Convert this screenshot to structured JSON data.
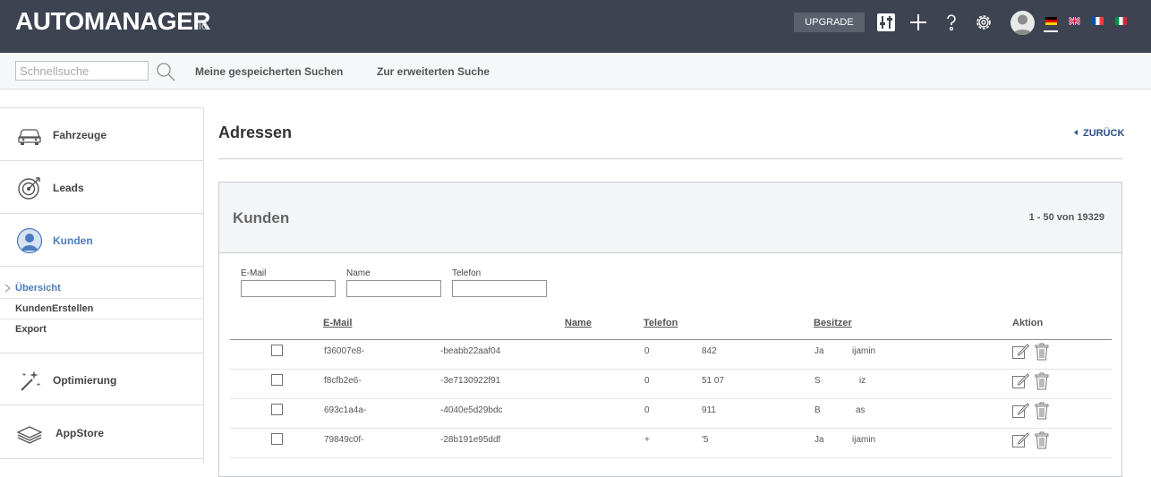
{
  "header": {
    "logo": "AUTOMANAGER",
    "logo_suffix": "io",
    "upgrade_label": "UPGRADE",
    "icons": [
      "sliders-icon",
      "plus-icon",
      "help-icon",
      "gear-icon",
      "avatar",
      "flag-de-icon",
      "flag-gb-icon",
      "flag-fr-icon",
      "flag-it-icon"
    ]
  },
  "searchbar": {
    "placeholder": "Schnellsuche",
    "saved_searches": "Meine gespeicherten Suchen",
    "advanced_search": "Zur erweiterten Suche"
  },
  "sidebar": {
    "items": [
      {
        "label": "Fahrzeuge",
        "icon": "car-icon"
      },
      {
        "label": "Leads",
        "icon": "target-icon"
      },
      {
        "label": "Kunden",
        "icon": "person-icon"
      },
      {
        "label": "Optimierung",
        "icon": "magic-wand-icon"
      },
      {
        "label": "AppStore",
        "icon": "layers-icon"
      }
    ],
    "sub_items": [
      {
        "label": "Übersicht"
      },
      {
        "label": "KundenErstellen"
      },
      {
        "label": "Export"
      }
    ]
  },
  "main": {
    "title": "Adressen",
    "back_label": "ZURÜCK",
    "panel_title": "Kunden",
    "count": "1 - 50 von 19329",
    "filters": {
      "email": "E-Mail",
      "name": "Name",
      "phone": "Telefon"
    },
    "columns": {
      "email": "E-Mail",
      "name": "Name",
      "phone": "Telefon",
      "owner": "Besitzer",
      "action": "Aktion"
    },
    "rows": [
      {
        "email": "f36007e8-",
        "name": "-beabb22aaf04",
        "phone_a": "0",
        "phone_b": "842",
        "owner_a": "Ja",
        "owner_b": "ijamin"
      },
      {
        "email": "f8cfb2e6-",
        "name": "-3e7130922f91",
        "phone_a": "0",
        "phone_b": "51 07",
        "owner_a": "S",
        "owner_b": "iz"
      },
      {
        "email": "693c1a4a-",
        "name": "-4040e5d29bdc",
        "phone_a": "0",
        "phone_b": "911",
        "owner_a": "B",
        "owner_b": "as"
      },
      {
        "email": "79849c0f-",
        "name": "-28b191e95ddf",
        "phone_a": "+",
        "phone_b": "'5",
        "owner_a": "Ja",
        "owner_b": "ijamin"
      }
    ]
  }
}
